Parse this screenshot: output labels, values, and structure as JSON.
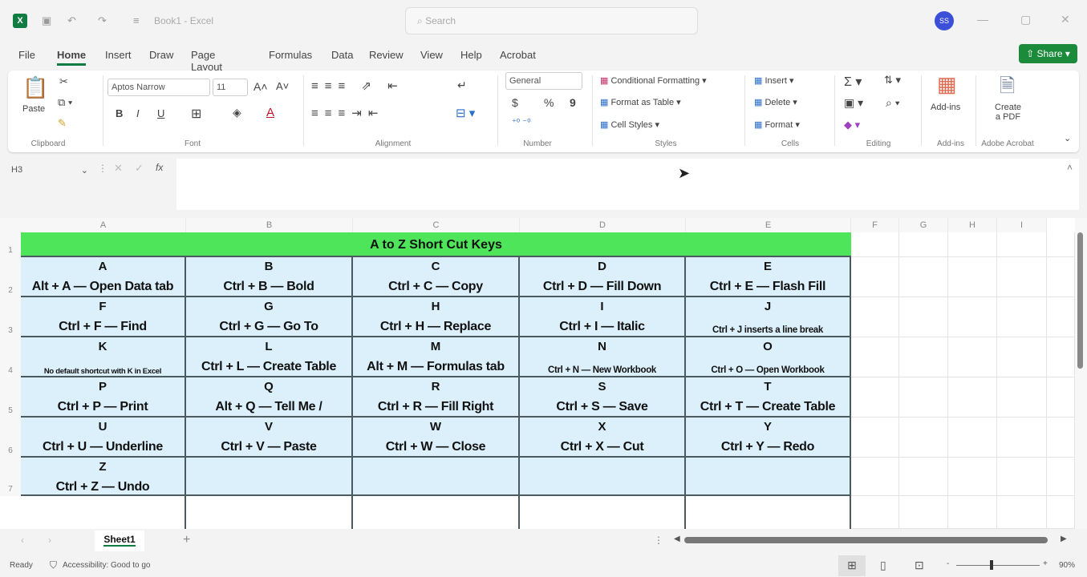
{
  "titlebar": {
    "app_letter": "X",
    "title": "Book1 - Excel",
    "search_placeholder": "Search",
    "avatar": "SS",
    "undo": "↶",
    "redo": "↷",
    "save": "▣",
    "customize": "≡",
    "minimize": "—",
    "maximize": "▢",
    "close": "✕"
  },
  "menu": {
    "tabs": [
      "File",
      "Home",
      "Insert",
      "Draw",
      "Page Layout",
      "Formulas",
      "Data",
      "Review",
      "View",
      "Help",
      "Acrobat"
    ],
    "active": "Home",
    "share": "Share"
  },
  "ribbon": {
    "clipboard": {
      "paste": "Paste",
      "label": "Clipboard"
    },
    "font": {
      "name": "Aptos Narrow",
      "size": "11",
      "bold": "B",
      "italic": "I",
      "underline": "U",
      "label": "Font"
    },
    "alignment": {
      "label": "Alignment"
    },
    "number": {
      "format": "General",
      "currency": "$",
      "percent": "%",
      "comma": "9",
      "label": "Number"
    },
    "styles": {
      "items": [
        "Conditional Formatting",
        "Format as Table",
        "Cell Styles"
      ],
      "label": "Styles"
    },
    "cells": {
      "items": [
        "Insert",
        "Delete",
        "Format"
      ],
      "label": "Cells"
    },
    "editing": {
      "label": "Editing",
      "sum": "Σ"
    },
    "addins": {
      "button": "Add-ins",
      "label": "Add-ins"
    },
    "acrobat": {
      "button_line1": "Create",
      "button_line2": "a PDF",
      "label": "Adobe Acrobat"
    }
  },
  "formula_bar": {
    "name_box": "H3",
    "fx": "fx",
    "value": ""
  },
  "sheet": {
    "columns": [
      "A",
      "B",
      "C",
      "D",
      "E",
      "F",
      "G",
      "H",
      "I"
    ],
    "rows": [
      "1",
      "2",
      "3",
      "4",
      "5",
      "6",
      "7"
    ],
    "title": "A to Z Short Cut Keys",
    "cells": [
      [
        {
          "k": "A",
          "s": "Alt + A — Open Data tab"
        },
        {
          "k": "B",
          "s": "Ctrl + B — Bold"
        },
        {
          "k": "C",
          "s": "Ctrl + C — Copy"
        },
        {
          "k": "D",
          "s": "Ctrl + D — Fill Down"
        },
        {
          "k": "E",
          "s": "Ctrl + E — Flash Fill"
        }
      ],
      [
        {
          "k": "F",
          "s": "Ctrl + F — Find"
        },
        {
          "k": "G",
          "s": "Ctrl + G — Go To"
        },
        {
          "k": "H",
          "s": "Ctrl + H — Replace"
        },
        {
          "k": "I",
          "s": "Ctrl + I — Italic"
        },
        {
          "k": "J",
          "s": "Ctrl + J inserts a line break",
          "size": "sm"
        }
      ],
      [
        {
          "k": "K",
          "s": "No default shortcut with K in Excel",
          "size": "xs"
        },
        {
          "k": "L",
          "s": "Ctrl + L — Create Table"
        },
        {
          "k": "M",
          "s": "Alt + M — Formulas tab"
        },
        {
          "k": "N",
          "s": "Ctrl + N — New Workbook",
          "size": "sm"
        },
        {
          "k": "O",
          "s": "Ctrl + O — Open Workbook",
          "size": "sm"
        }
      ],
      [
        {
          "k": "P",
          "s": "Ctrl + P — Print"
        },
        {
          "k": "Q",
          "s": "Alt + Q — Tell Me /"
        },
        {
          "k": "R",
          "s": "Ctrl + R — Fill Right"
        },
        {
          "k": "S",
          "s": "Ctrl + S — Save"
        },
        {
          "k": "T",
          "s": "Ctrl + T — Create Table"
        }
      ],
      [
        {
          "k": "U",
          "s": "Ctrl + U — Underline"
        },
        {
          "k": "V",
          "s": "Ctrl + V — Paste"
        },
        {
          "k": "W",
          "s": "Ctrl + W — Close"
        },
        {
          "k": "X",
          "s": "Ctrl + X — Cut"
        },
        {
          "k": "Y",
          "s": "Ctrl + Y — Redo"
        }
      ],
      [
        {
          "k": "Z",
          "s": "Ctrl + Z — Undo"
        },
        {
          "k": "",
          "s": ""
        },
        {
          "k": "",
          "s": ""
        },
        {
          "k": "",
          "s": ""
        },
        {
          "k": "",
          "s": ""
        }
      ]
    ],
    "tab": "Sheet1",
    "add_sheet": "+"
  },
  "status": {
    "ready": "Ready",
    "accessibility": "Accessibility: Good to go",
    "zoom": "90%",
    "minus": "-",
    "plus": "+"
  }
}
